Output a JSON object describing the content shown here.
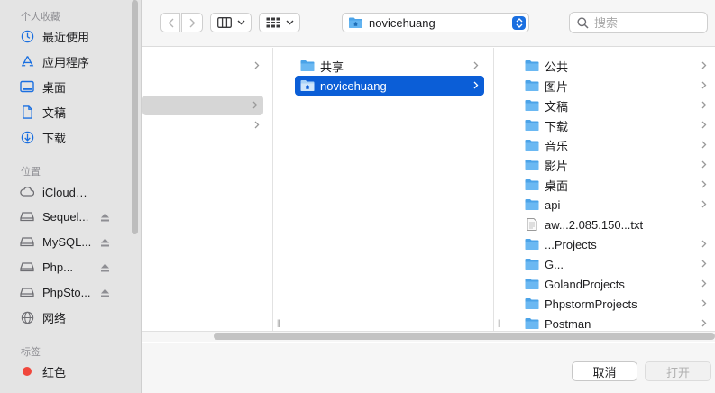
{
  "sidebar": {
    "favorites_header": "个人收藏",
    "favorites": [
      {
        "label": "最近使用",
        "icon": "clock-icon"
      },
      {
        "label": "应用程序",
        "icon": "applications-icon"
      },
      {
        "label": "桌面",
        "icon": "desktop-icon"
      },
      {
        "label": "文稿",
        "icon": "document-icon"
      },
      {
        "label": "下载",
        "icon": "download-icon"
      }
    ],
    "locations_header": "位置",
    "locations": [
      {
        "label": "iCloud云盘",
        "icon": "cloud-icon",
        "eject": false
      },
      {
        "label": "Sequel...",
        "icon": "drive-icon",
        "eject": true
      },
      {
        "label": "MySQL...",
        "icon": "drive-icon",
        "eject": true
      },
      {
        "label": "Php...",
        "icon": "drive-icon",
        "eject": true
      },
      {
        "label": "PhpSto...",
        "icon": "drive-icon",
        "eject": true
      },
      {
        "label": "网络",
        "icon": "globe-icon",
        "eject": false
      }
    ],
    "tags_header": "标签",
    "tags": [
      {
        "label": "红色",
        "color": "#f0473c"
      }
    ]
  },
  "toolbar": {
    "current_folder": "novicehuang",
    "search_placeholder": "搜索"
  },
  "columns": {
    "col2": [
      {
        "label": "共享",
        "selected": false
      },
      {
        "label": "novicehuang",
        "selected": true
      }
    ],
    "col3": [
      {
        "label": "公共",
        "type": "folder",
        "chevron": true
      },
      {
        "label": "图片",
        "type": "folder",
        "chevron": true
      },
      {
        "label": "文稿",
        "type": "folder",
        "chevron": true
      },
      {
        "label": "下载",
        "type": "folder",
        "chevron": true
      },
      {
        "label": "音乐",
        "type": "folder",
        "chevron": true
      },
      {
        "label": "影片",
        "type": "folder",
        "chevron": true
      },
      {
        "label": "桌面",
        "type": "folder",
        "chevron": true
      },
      {
        "label": "api",
        "type": "folder",
        "chevron": true
      },
      {
        "label": "aw...2.085.150...txt",
        "type": "file",
        "chevron": false
      },
      {
        "label": "...Projects",
        "type": "folder",
        "chevron": true
      },
      {
        "label": "G...",
        "type": "folder",
        "chevron": true
      },
      {
        "label": "GolandProjects",
        "type": "folder",
        "chevron": true
      },
      {
        "label": "PhpstormProjects",
        "type": "folder",
        "chevron": true
      },
      {
        "label": "Postman",
        "type": "folder",
        "chevron": true
      }
    ]
  },
  "footer": {
    "cancel_label": "取消",
    "open_label": "打开"
  },
  "colors": {
    "accent": "#0b5ed7",
    "folder": "#4ba3e8"
  }
}
